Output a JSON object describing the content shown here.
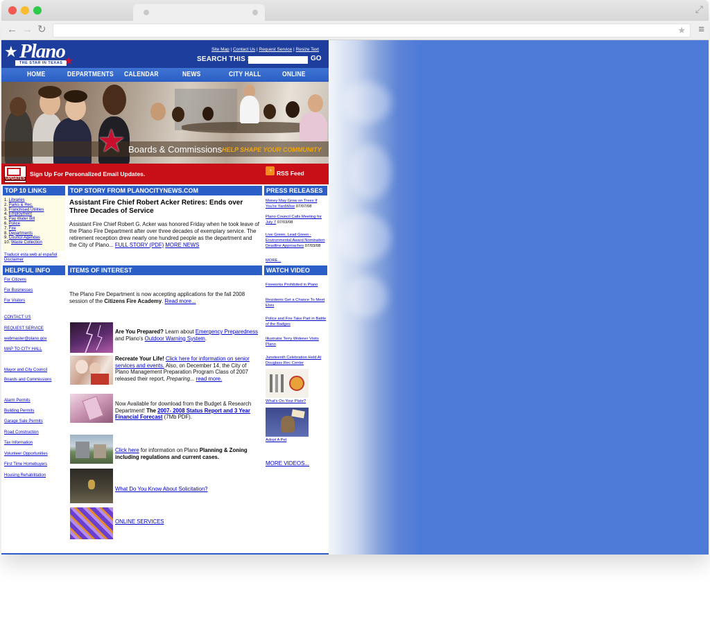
{
  "site": {
    "logo_text": "lano",
    "logo_letter": "P",
    "tagline": "THE STAR IN TEXAS",
    "top_links": [
      "Site Map",
      "Contact Us",
      "Request Service",
      "Resize Text"
    ],
    "search_label": "SEARCH THIS SITE",
    "search_value": "",
    "go_label": "GO",
    "nav": [
      "HOME",
      "DEPARTMENTS",
      "CALENDAR",
      "NEWS",
      "CITY HALL",
      "ONLINE"
    ],
    "banner_title": "Boards & Commissions",
    "banner_sub": "HELP SHAPE YOUR COMMUNITY",
    "updates_icon_label": "UPDATES",
    "signup": "Sign Up For Personalized Email Updates.",
    "rss_label": "RSS Feed"
  },
  "left": {
    "top10_header": "TOP 10 LINKS",
    "top10": [
      "Libraries",
      "Parks & Rec.",
      "Franchised Utilities",
      "Employment",
      "Pay Water Bill",
      "Police",
      "Fire",
      "Departments",
      "Council Agendas",
      "Waste Collection"
    ],
    "traducir": "Traducir esta web al español",
    "disclaimer": "Disclaimer",
    "helpful_header": "HELPFUL INFO",
    "helpful": [
      "For Citizens",
      "For Businesses",
      "For Visitors",
      "CONTACT US",
      "REQUEST SERVICE",
      "webmaster@plano.gov",
      "MAP TO CITY HALL",
      "Mayor and City Council",
      "Boards and Commissions",
      "Alarm Permits",
      "Building Permits",
      "Garage Sale Permits",
      "Road Construction",
      "Tax Information",
      "Volunteer Opportunities",
      "First Time Homebuyers",
      "Housing Rehabilitation"
    ]
  },
  "center": {
    "story_header": "TOP STORY FROM PLANOCITYNEWS.COM",
    "story_title": "Assistant Fire Chief Robert Acker Retires: Ends over Three Decades of Service",
    "story_body": "Assistant Fire Chief Robert G. Acker was honored Friday when he took leave of the Plano Fire Department after over three decades of exemplary service. The retirement reception drew nearly one hundred people as the department and the City of Plano...",
    "full_story": "FULL STORY (PDF)",
    "more_news": "MORE NEWS",
    "items_header": "ITEMS OF INTEREST",
    "academy_text": "The Plano Fire Department is now accepting applications for the fall 2008 session of the ",
    "academy_bold": "Citizens Fire Academy",
    "academy_link": "Read more...",
    "item1_bold": "Are You Prepared?",
    "item1_text1": " Learn about ",
    "item1_link1": "Emergency Preparedness",
    "item1_text2": " and Plano's ",
    "item1_link2": "Outdoor Warning System",
    "item2_bold": "Recreate Your Life!",
    "item2_link1": "Click here for information on senior services and events.",
    "item2_text": " Also, on December 14, the City of Plano Management Preparation Program Class of 2007 released their report, ",
    "item2_italic": "Preparing...",
    "item2_link2": "read more.",
    "item3_text1": "Now Available for download from the Budget & Research Department! ",
    "item3_bold": "The ",
    "item3_link": "2007- 2008 Status Report and 3 Year Financial Forecast",
    "item3_text2": " (7Mb PDF).",
    "item4_link": "Click here",
    "item4_text": " for information on Plano ",
    "item4_bold": "Planning & Zoning including regulations and current cases.",
    "item5_link": "What Do You Know About Solicitation?",
    "item6_link": "ONLINE SERVICES"
  },
  "right": {
    "press_header": "PRESS RELEASES",
    "press": [
      {
        "title": "Money May Grow on Trees If You're YardWise",
        "date": "07/07/08"
      },
      {
        "title": "Plano Council Calls Meeting for July 7",
        "date": "07/03/08"
      },
      {
        "title": "Live Green, Lead Green - Environmental Award Nomination Deadline Approaches",
        "date": "07/03/08"
      }
    ],
    "press_more": "MORE...",
    "video_header": "WATCH VIDEO",
    "videos": [
      "Fireworks Prohibited in Plano",
      "Residents Get a Chance To Meet Elvis",
      "Police and Fire Take Part in Battle of the Badges",
      "Illustrator Terry Widener Visits Plano",
      "Juneteenth Celebration Held At Douglass Rec Center",
      "What's On Your Plate?",
      "Adopt A Pet"
    ],
    "more_videos": "MORE VIDEOS..."
  },
  "colors": {
    "header_blue": "#1e3e9d",
    "nav_blue": "#2c5ec4",
    "section_blue": "#2b5ec7",
    "red_bar": "#c80e16",
    "link_blue": "#0000cc",
    "banner_orange": "#f2a70a",
    "background_blue": "#4f7bd8"
  }
}
